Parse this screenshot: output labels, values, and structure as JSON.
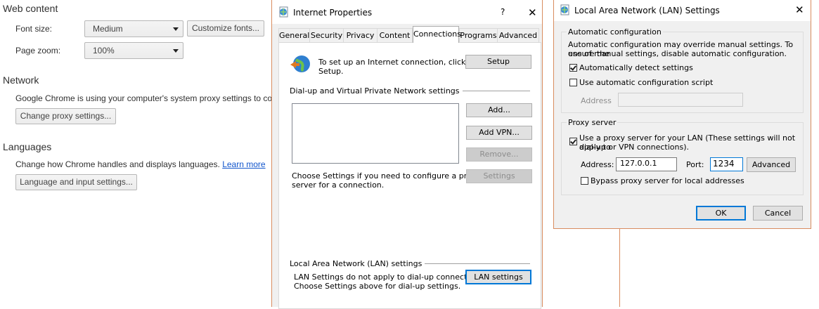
{
  "chrome": {
    "web_content": {
      "title": "Web content",
      "font_size_label": "Font size:",
      "font_size_value": "Medium",
      "customize_fonts_button": "Customize fonts...",
      "page_zoom_label": "Page zoom:",
      "page_zoom_value": "100%"
    },
    "network": {
      "title": "Network",
      "description": "Google Chrome is using your computer's system proxy settings to conr",
      "change_proxy_button": "Change proxy settings..."
    },
    "languages": {
      "title": "Languages",
      "description": "Change how Chrome handles and displays languages.",
      "learn_more_link": "Learn more",
      "language_button": "Language and input settings..."
    }
  },
  "internet_properties": {
    "title": "Internet Properties",
    "help_glyph": "?",
    "close_glyph": "✕",
    "tabs": [
      "General",
      "Security",
      "Privacy",
      "Content",
      "Connections",
      "Programs",
      "Advanced"
    ],
    "active_tab": "Connections",
    "setup_text_1": "To set up an Internet connection, click",
    "setup_text_2": "Setup.",
    "setup_button": "Setup",
    "dialup_group": "Dial-up and Virtual Private Network settings",
    "add_button": "Add...",
    "add_vpn_button": "Add VPN...",
    "remove_button": "Remove...",
    "settings_button": "Settings",
    "choose_text_1": "Choose Settings if you need to configure a proxy",
    "choose_text_2": "server for a connection.",
    "lan_group": "Local Area Network (LAN) settings",
    "lan_text_1": "LAN Settings do not apply to dial-up connections.",
    "lan_text_2": "Choose Settings above for dial-up settings.",
    "lan_settings_button": "LAN settings"
  },
  "lan_settings": {
    "title": "Local Area Network (LAN) Settings",
    "close_glyph": "✕",
    "auto_group": "Automatic configuration",
    "auto_text_1": "Automatic configuration may override manual settings.  To ensure the",
    "auto_text_2": "use of manual settings, disable automatic configuration.",
    "auto_detect_label": "Automatically detect settings",
    "auto_detect_checked": true,
    "use_script_label": "Use automatic configuration script",
    "use_script_checked": false,
    "script_address_label": "Address",
    "script_address_value": "",
    "proxy_group": "Proxy server",
    "use_proxy_label_1": "Use a proxy server for your LAN (These settings will not apply to",
    "use_proxy_label_2": "dial-up or VPN connections).",
    "use_proxy_checked": true,
    "address_label": "Address:",
    "address_value": "127.0.0.1",
    "port_label": "Port:",
    "port_value": "1234",
    "advanced_button": "Advanced",
    "bypass_label": "Bypass proxy server for local addresses",
    "bypass_checked": false,
    "ok_button": "OK",
    "cancel_button": "Cancel"
  }
}
